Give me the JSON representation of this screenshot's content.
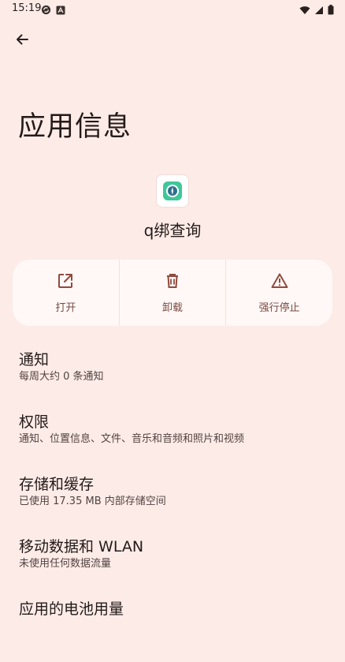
{
  "status_bar": {
    "time": "15:19"
  },
  "page": {
    "title": "应用信息"
  },
  "app": {
    "name": "q绑查询"
  },
  "actions": [
    {
      "label": "打开"
    },
    {
      "label": "卸载"
    },
    {
      "label": "强行停止"
    }
  ],
  "settings": [
    {
      "title": "通知",
      "subtitle": "每周大约 0 条通知"
    },
    {
      "title": "权限",
      "subtitle": "通知、位置信息、文件、音乐和音频和照片和视频"
    },
    {
      "title": "存储和缓存",
      "subtitle": "已使用 17.35 MB 内部存储空间"
    },
    {
      "title": "移动数据和 WLAN",
      "subtitle": "未使用任何数据流量"
    },
    {
      "title": "应用的电池用量",
      "subtitle": ""
    }
  ],
  "colors": {
    "background": "#fcebe7",
    "card": "#fff8f6",
    "accent": "#8f4a3f"
  }
}
